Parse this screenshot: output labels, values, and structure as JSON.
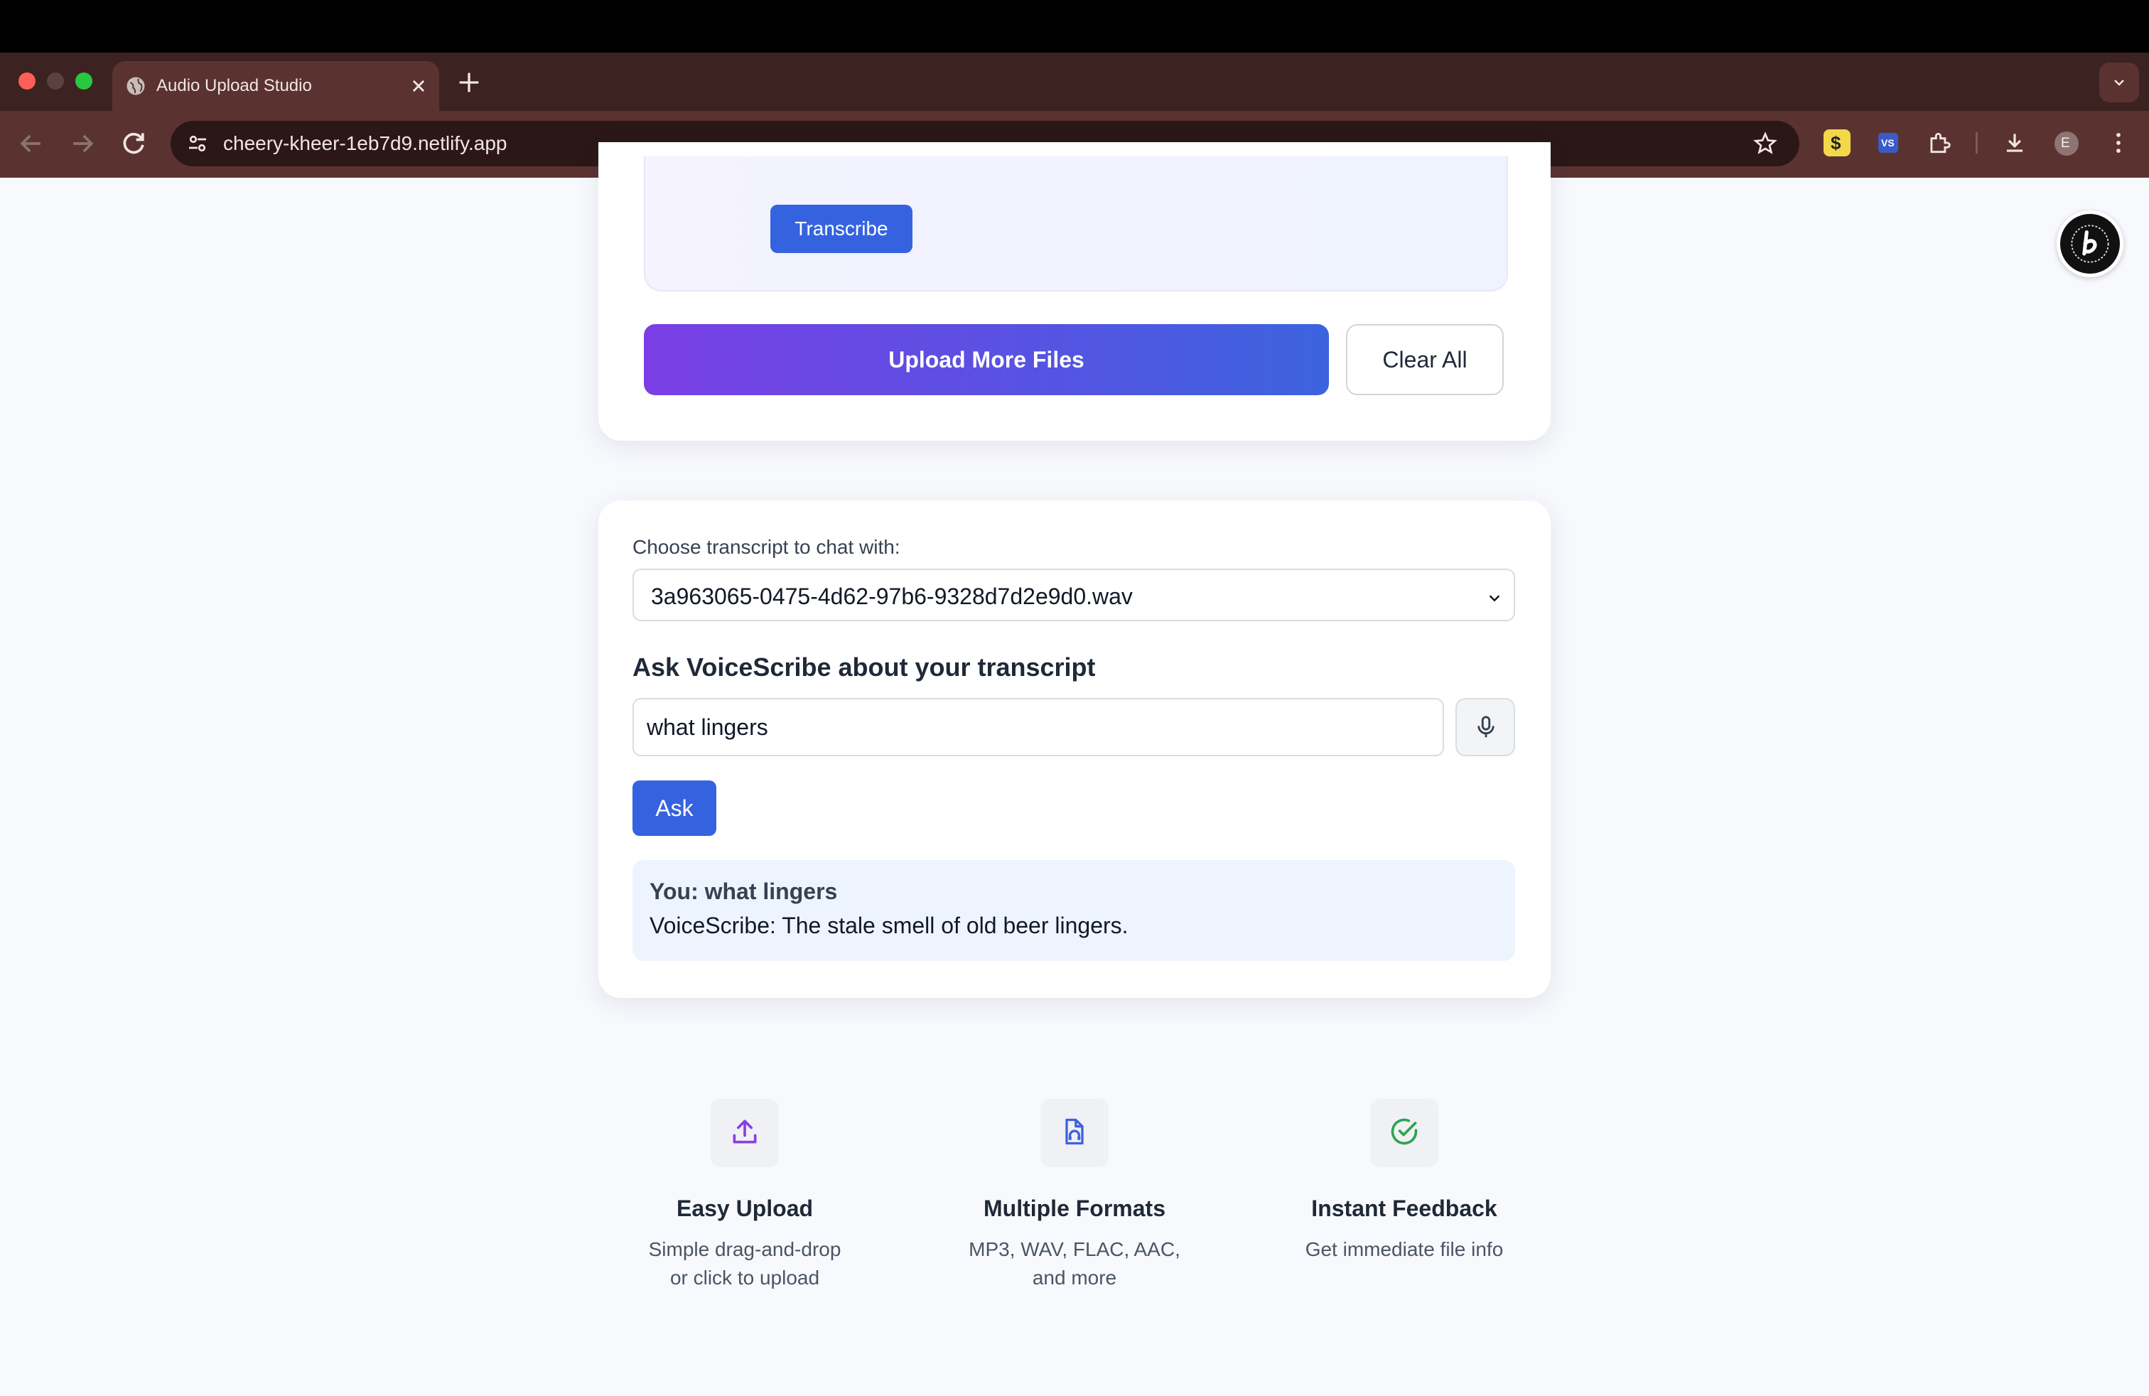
{
  "browser": {
    "tab_title": "Audio Upload Studio",
    "url": "cheery-kheer-1eb7d9.netlify.app",
    "profile_initial": "E",
    "extension_label": "VS"
  },
  "upload_card": {
    "transcribe_label": "Transcribe",
    "upload_more_label": "Upload More Files",
    "clear_all_label": "Clear All"
  },
  "chat_card": {
    "select_label": "Choose transcript to chat with:",
    "selected_transcript": "3a963065-0475-4d62-97b6-9328d7d2e9d0.wav",
    "heading": "Ask VoiceScribe about your transcript",
    "question_value": "what lingers",
    "ask_label": "Ask",
    "conversation": {
      "user_line": "You: what lingers",
      "bot_line": "VoiceScribe: The stale smell of old beer lingers."
    }
  },
  "features": [
    {
      "icon": "upload-icon",
      "title": "Easy Upload",
      "desc_line1": "Simple drag-and-drop",
      "desc_line2": "or click to upload"
    },
    {
      "icon": "audio-file-icon",
      "title": "Multiple Formats",
      "desc_line1": "MP3, WAV, FLAC, AAC,",
      "desc_line2": "and more"
    },
    {
      "icon": "check-circle-icon",
      "title": "Instant Feedback",
      "desc_line1": "Get immediate file info",
      "desc_line2": ""
    }
  ],
  "colors": {
    "accent_blue": "#3563e0",
    "gradient_start": "#7a3ee4",
    "gradient_end": "#3c63e0",
    "chrome_bg": "#5a3330"
  }
}
